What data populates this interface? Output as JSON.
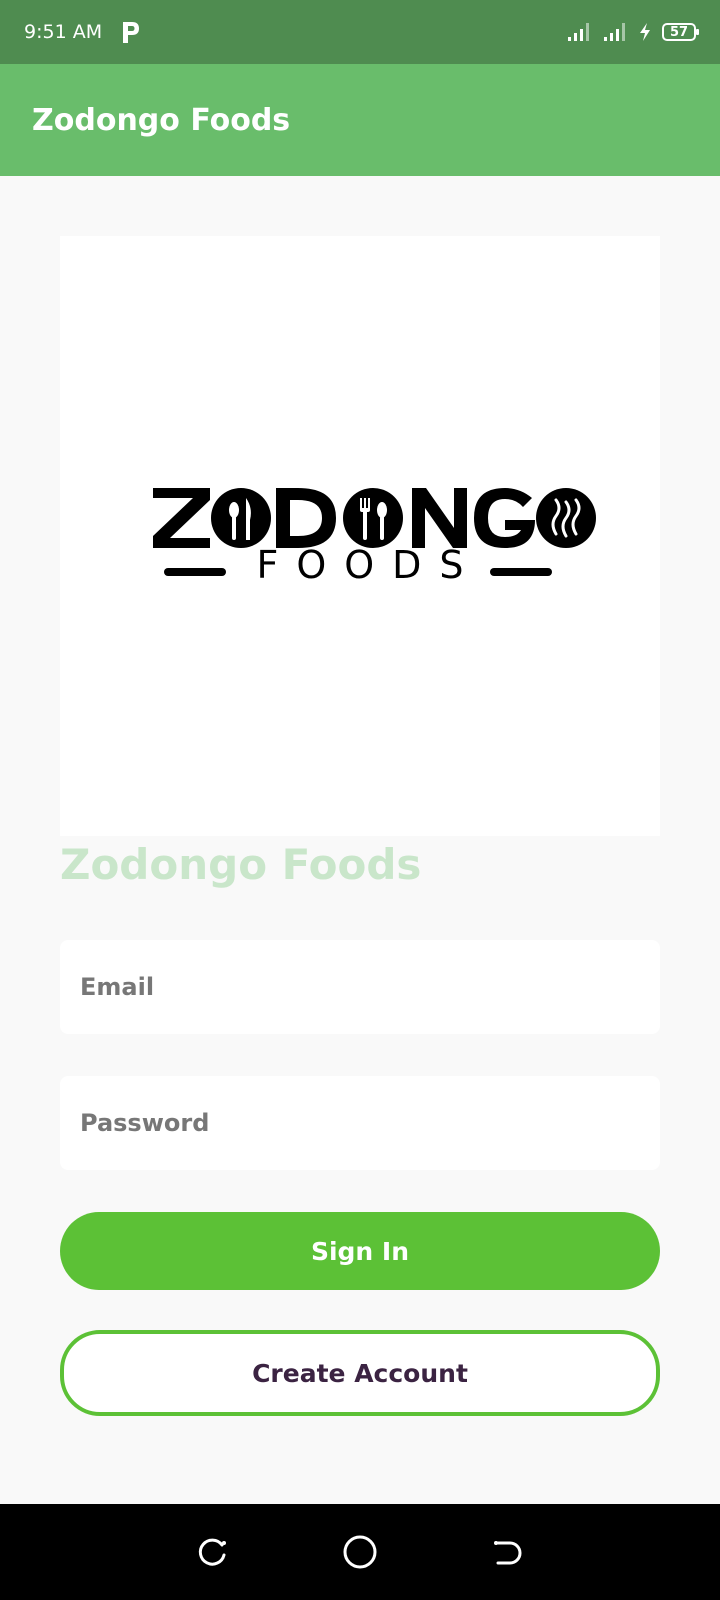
{
  "status_bar": {
    "time": "9:51 AM",
    "notification_icon": "p-app-icon",
    "signal_icons": [
      "signal-icon",
      "signal-icon"
    ],
    "charging_icon": "bolt-icon",
    "battery": "57"
  },
  "app_bar": {
    "title": "Zodongo Foods"
  },
  "logo": {
    "wordmark": "ZODONGO",
    "subtitle": "FOODS",
    "icons": [
      "spoon-knife-icon",
      "fork-knife-icon",
      "steam-icon"
    ]
  },
  "brand_heading": "Zodongo Foods",
  "form": {
    "email_placeholder": "Email",
    "password_placeholder": "Password",
    "sign_in_label": "Sign In",
    "create_account_label": "Create Account"
  },
  "nav_bar": {
    "icons": [
      "recents-icon",
      "home-icon",
      "back-icon"
    ]
  },
  "colors": {
    "status_bar": "#4f8c50",
    "app_bar": "#69bd6b",
    "accent": "#5cc136",
    "heading_tint": "#c9e6ca",
    "create_text": "#3b2342"
  }
}
